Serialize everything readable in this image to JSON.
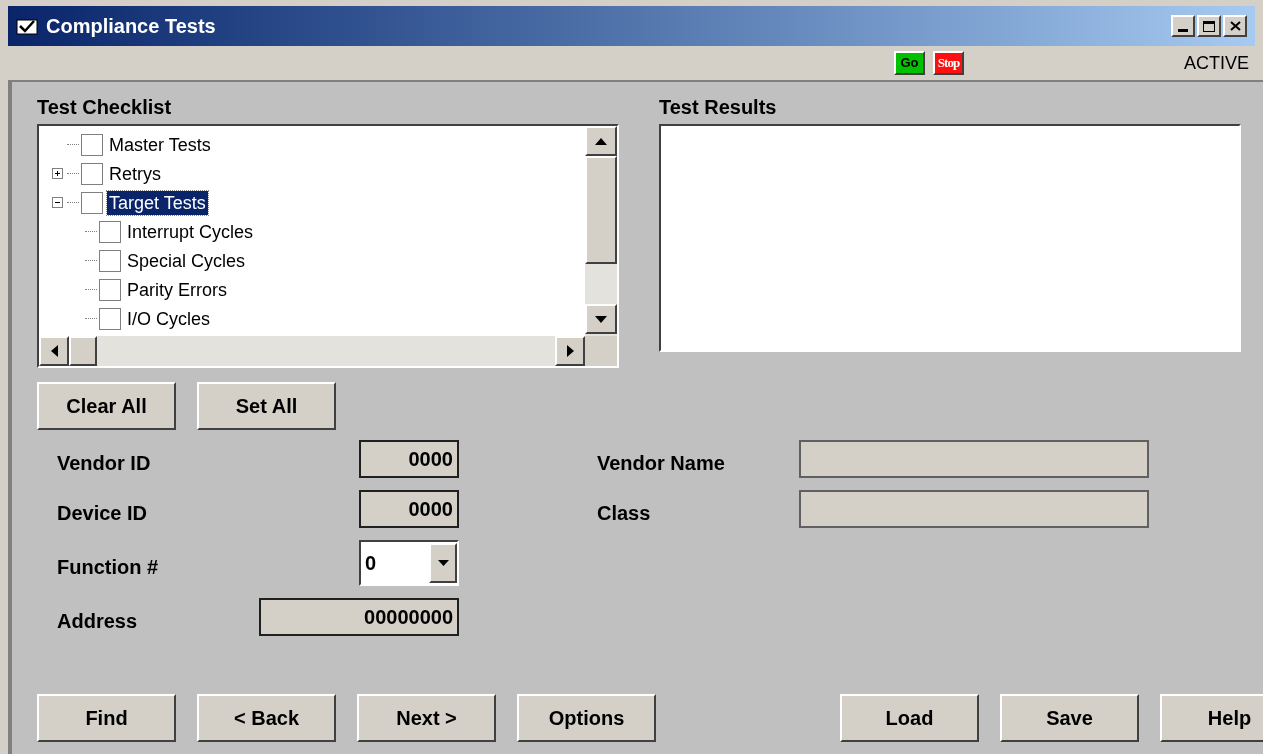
{
  "window": {
    "title": "Compliance Tests"
  },
  "toolbar": {
    "buttons": [
      {
        "kind": "go",
        "label": "Go"
      },
      {
        "kind": "stop",
        "label": "Stop"
      }
    ],
    "status": "ACTIVE"
  },
  "checklist": {
    "label": "Test Checklist",
    "items": [
      {
        "label": "Master Tests",
        "checked": false,
        "selected": false
      },
      {
        "label": "Retrys",
        "checked": false,
        "selected": false,
        "expanded": false
      },
      {
        "label": "Target Tests",
        "checked": false,
        "selected": true,
        "expanded": true,
        "children": [
          {
            "label": "Interrupt Cycles",
            "checked": false,
            "selected": false
          },
          {
            "label": "Special Cycles",
            "checked": false,
            "selected": false
          },
          {
            "label": "Parity Errors",
            "checked": false,
            "selected": false
          },
          {
            "label": "I/O Cycles",
            "checked": false,
            "selected": false
          }
        ]
      }
    ]
  },
  "results": {
    "label": "Test Results"
  },
  "list_buttons": [
    {
      "label": "Clear All"
    },
    {
      "label": "Set All"
    }
  ],
  "fields_left": [
    {
      "kind": "text",
      "label": "Vendor ID",
      "value": "0000"
    },
    {
      "kind": "text",
      "label": "Device ID",
      "value": "0000"
    },
    {
      "kind": "select",
      "label": "Function #",
      "value": "0"
    },
    {
      "kind": "wide",
      "label": "Address",
      "value": "00000000"
    }
  ],
  "fields_right": [
    {
      "label": "Vendor Name"
    },
    {
      "label": "Class"
    }
  ],
  "nav_buttons": [
    {
      "label": "Find"
    },
    {
      "label": "< Back"
    },
    {
      "label": "Next >"
    },
    {
      "label": "Options"
    }
  ],
  "file_buttons": [
    {
      "label": "Load"
    },
    {
      "label": "Save"
    },
    {
      "label": "Help"
    }
  ]
}
